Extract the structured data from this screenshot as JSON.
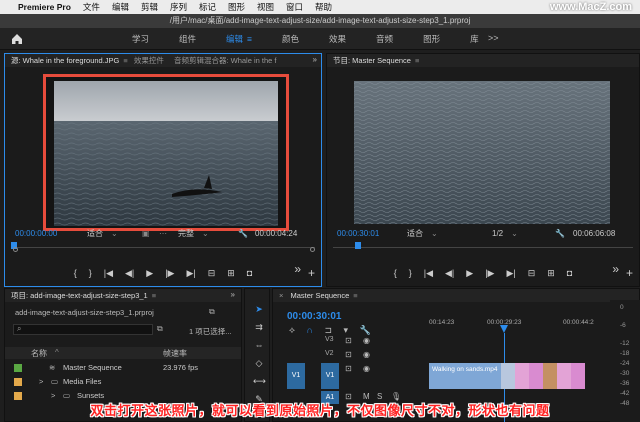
{
  "menubar": {
    "app_name": "Premiere Pro",
    "items": [
      "文件",
      "编辑",
      "剪辑",
      "序列",
      "标记",
      "图形",
      "视图",
      "窗口",
      "帮助"
    ],
    "watermark": "www.MacZ.com"
  },
  "titlebar": {
    "path": "/用户/mac/桌面/add-image-text-adjust-size/add-image-text-adjust-size-step3_1.prproj"
  },
  "workspaces": {
    "tabs": [
      "学习",
      "组件",
      "编辑",
      "颜色",
      "效果",
      "音频",
      "图形",
      "库"
    ],
    "active": "编辑",
    "more": ">>"
  },
  "source": {
    "tab_label": "源: Whale in the foreground.JPG",
    "tab2": "效果控件",
    "tab3": "音频剪辑混合器: Whale in the f",
    "timecode_in": "00:00:00:00",
    "fit": "适合",
    "quality": "完整",
    "timecode_out": "00:00:04:24"
  },
  "program": {
    "tab_label": "节目: Master Sequence",
    "timecode_in": "00:00:30:01",
    "fit": "适合",
    "quality": "1/2",
    "timecode_out": "00:06:06:08"
  },
  "project": {
    "tab_label": "项目: add-image-text-adjust-size-step3_1",
    "file": "add-image-text-adjust-size-step3_1.prproj",
    "count": "1 项已选择...",
    "col_name": "名称",
    "col_fps": "帧速率",
    "rows": [
      {
        "name": "Master Sequence",
        "fps": "23.976 fps",
        "color": "#5aa843"
      },
      {
        "name": "Media Files",
        "fps": "",
        "color": "#e3a94b"
      },
      {
        "name": "Sunsets",
        "fps": "",
        "color": "#e3a94b"
      }
    ]
  },
  "timeline": {
    "tab_label": "Master Sequence",
    "timecode": "00:00:30:01",
    "ruler": [
      "00:14:23",
      "00:00:29:23",
      "00:00:44:2"
    ],
    "tracks": [
      "V3",
      "V2",
      "V1",
      "A1"
    ],
    "clip_label": "Walking on sands.mp4",
    "meter_db": [
      "0",
      "-6",
      "-12",
      "-18",
      "-24",
      "-30",
      "-36",
      "-42",
      "-48"
    ]
  },
  "caption": "双击打开这张照片，就可以看到原始照片，不仅图像尺寸不对，形状也有问题"
}
